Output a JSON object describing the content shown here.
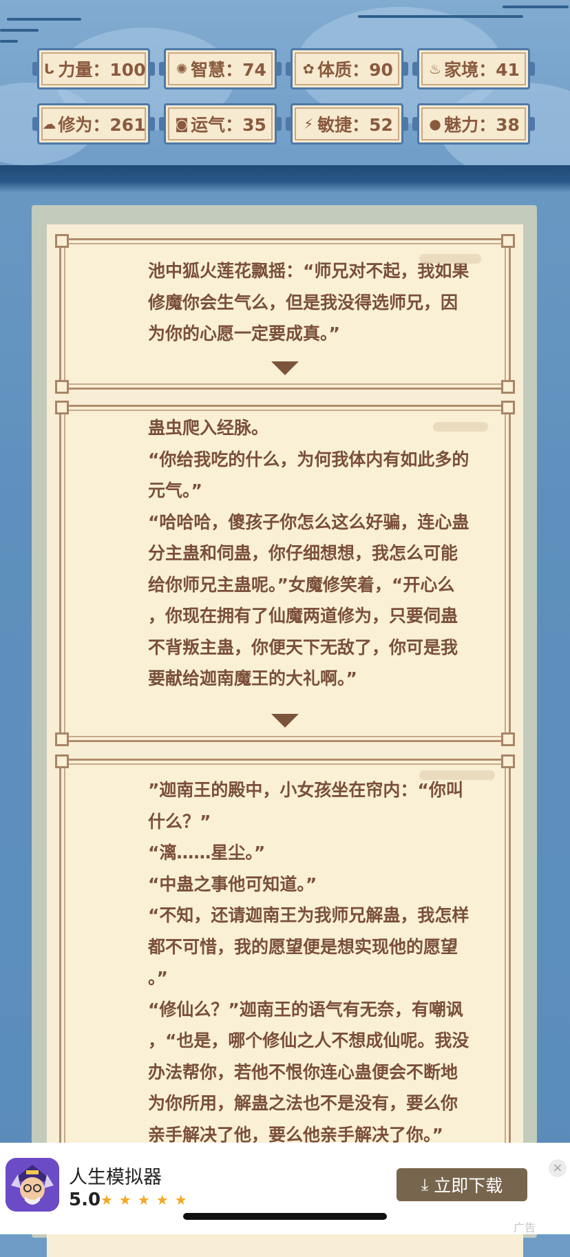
{
  "stats": [
    {
      "icon": "strength-icon",
      "glyph": "ᒐ",
      "label": "力量：100"
    },
    {
      "icon": "wisdom-icon",
      "glyph": "✺",
      "label": "智慧：74"
    },
    {
      "icon": "constitution-icon",
      "glyph": "✿",
      "label": "体质：90"
    },
    {
      "icon": "family-icon",
      "glyph": "♨",
      "label": "家境：41"
    },
    {
      "icon": "cultivation-icon",
      "glyph": "☁",
      "label": "修为：261"
    },
    {
      "icon": "luck-icon",
      "glyph": "◙",
      "label": "运气：35"
    },
    {
      "icon": "agility-icon",
      "glyph": "⚡",
      "label": "敏捷：52"
    },
    {
      "icon": "charm-icon",
      "glyph": "●",
      "label": "魅力：38"
    }
  ],
  "story": {
    "card1": {
      "lines": [
        "池中狐火莲花飘摇：“师兄对不起，我如果",
        "修魔你会生气么，但是我没得选师兄，因",
        "为你的心愿一定要成真。”"
      ]
    },
    "card2": {
      "lines": [
        "蛊虫爬入经脉。",
        "“你给我吃的什么，为何我体内有如此多的",
        "元气。”",
        "“哈哈哈，傻孩子你怎么这么好骗，连心蛊",
        "分主蛊和伺蛊，你仔细想想，我怎么可能",
        "给你师兄主蛊呢。”女魔修笑着，“开心么",
        "，你现在拥有了仙魔两道修为，只要伺蛊",
        "不背叛主蛊，你便天下无敌了，你可是我",
        "要献给迦南魔王的大礼啊。”"
      ]
    },
    "card3": {
      "lines": [
        "”迦南王的殿中，小女孩坐在帘内：“你叫",
        "什么？”",
        "“漓……星尘。”",
        "“中蛊之事他可知道。”",
        "“不知，还请迦南王为我师兄解蛊，我怎样",
        "都不可惜，我的愿望便是想实现他的愿望",
        "。”",
        "“修仙么？”迦南王的语气有无奈，有嘲讽",
        "，“也是，哪个修仙之人不想成仙呢。我没",
        "办法帮你，若他不恨你连心蛊便会不断地",
        "为你所用，解蛊之法也不是没有，要么你",
        "亲手解决了他，要么他亲手解决了你。”"
      ]
    }
  },
  "ad": {
    "app_name": "人生模拟器",
    "rating": "5.0",
    "stars": "★★★★★",
    "download_label": "立即下载",
    "close_glyph": "×",
    "ad_label": "广告"
  },
  "colors": {
    "accent_brown": "#7a4f3a",
    "stat_border": "#4d78a8",
    "download_button": "#77654d",
    "star": "#f5a623"
  }
}
